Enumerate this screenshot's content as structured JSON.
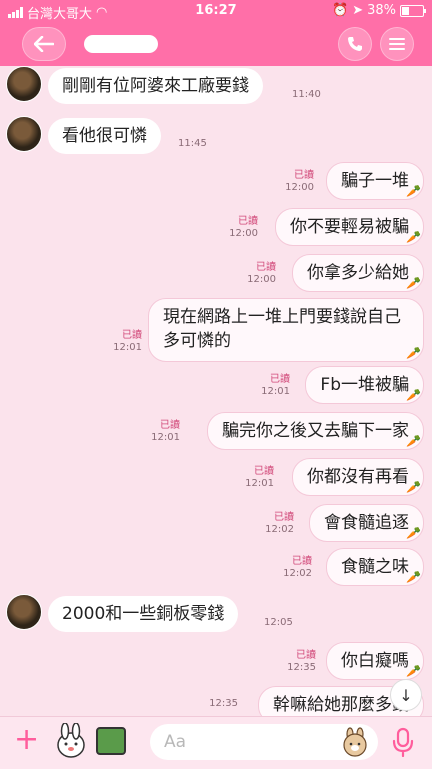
{
  "status": {
    "carrier": "台灣大哥大",
    "time": "16:27",
    "battery": "38%"
  },
  "header": {
    "title": ""
  },
  "messages": [
    {
      "side": "left",
      "text": "剛剛有位阿婆來工廠要錢",
      "time": "11:40"
    },
    {
      "side": "left",
      "text": "看他很可憐",
      "time": "11:45"
    },
    {
      "side": "right",
      "text": "騙子一堆",
      "read": "已讀",
      "time": "12:00"
    },
    {
      "side": "right",
      "text": "你不要輕易被騙",
      "read": "已讀",
      "time": "12:00"
    },
    {
      "side": "right",
      "text": "你拿多少給她",
      "read": "已讀",
      "time": "12:00"
    },
    {
      "side": "right",
      "text": "現在網路上一堆上門要錢說自己多可憐的",
      "read": "已讀",
      "time": "12:01"
    },
    {
      "side": "right",
      "text": "Fb一堆被騙",
      "read": "已讀",
      "time": "12:01"
    },
    {
      "side": "right",
      "text": "騙完你之後又去騙下一家",
      "read": "已讀",
      "time": "12:01"
    },
    {
      "side": "right",
      "text": "你都沒有再看",
      "read": "已讀",
      "time": "12:01"
    },
    {
      "side": "right",
      "text": "會食髓追逐",
      "read": "已讀",
      "time": "12:02"
    },
    {
      "side": "right",
      "text": "食髓之味",
      "read": "已讀",
      "time": "12:02"
    },
    {
      "side": "left",
      "text": "2000和一些銅板零錢",
      "time": "12:05"
    },
    {
      "side": "right",
      "text": "你白癡嗎",
      "read": "已讀",
      "time": "12:35"
    },
    {
      "side": "right",
      "text": "幹嘛給她那麼多錢",
      "read": "",
      "time": "12:35"
    }
  ],
  "input": {
    "placeholder": "Aa"
  },
  "colors": {
    "header": "#ff6fa8",
    "background": "#fbe3ec",
    "read_label": "#d24a7a"
  },
  "icons": {
    "back": "back-arrow-icon",
    "call": "phone-icon",
    "menu": "menu-icon",
    "add": "plus-icon",
    "mic": "microphone-icon",
    "scroll": "arrow-down-icon"
  }
}
